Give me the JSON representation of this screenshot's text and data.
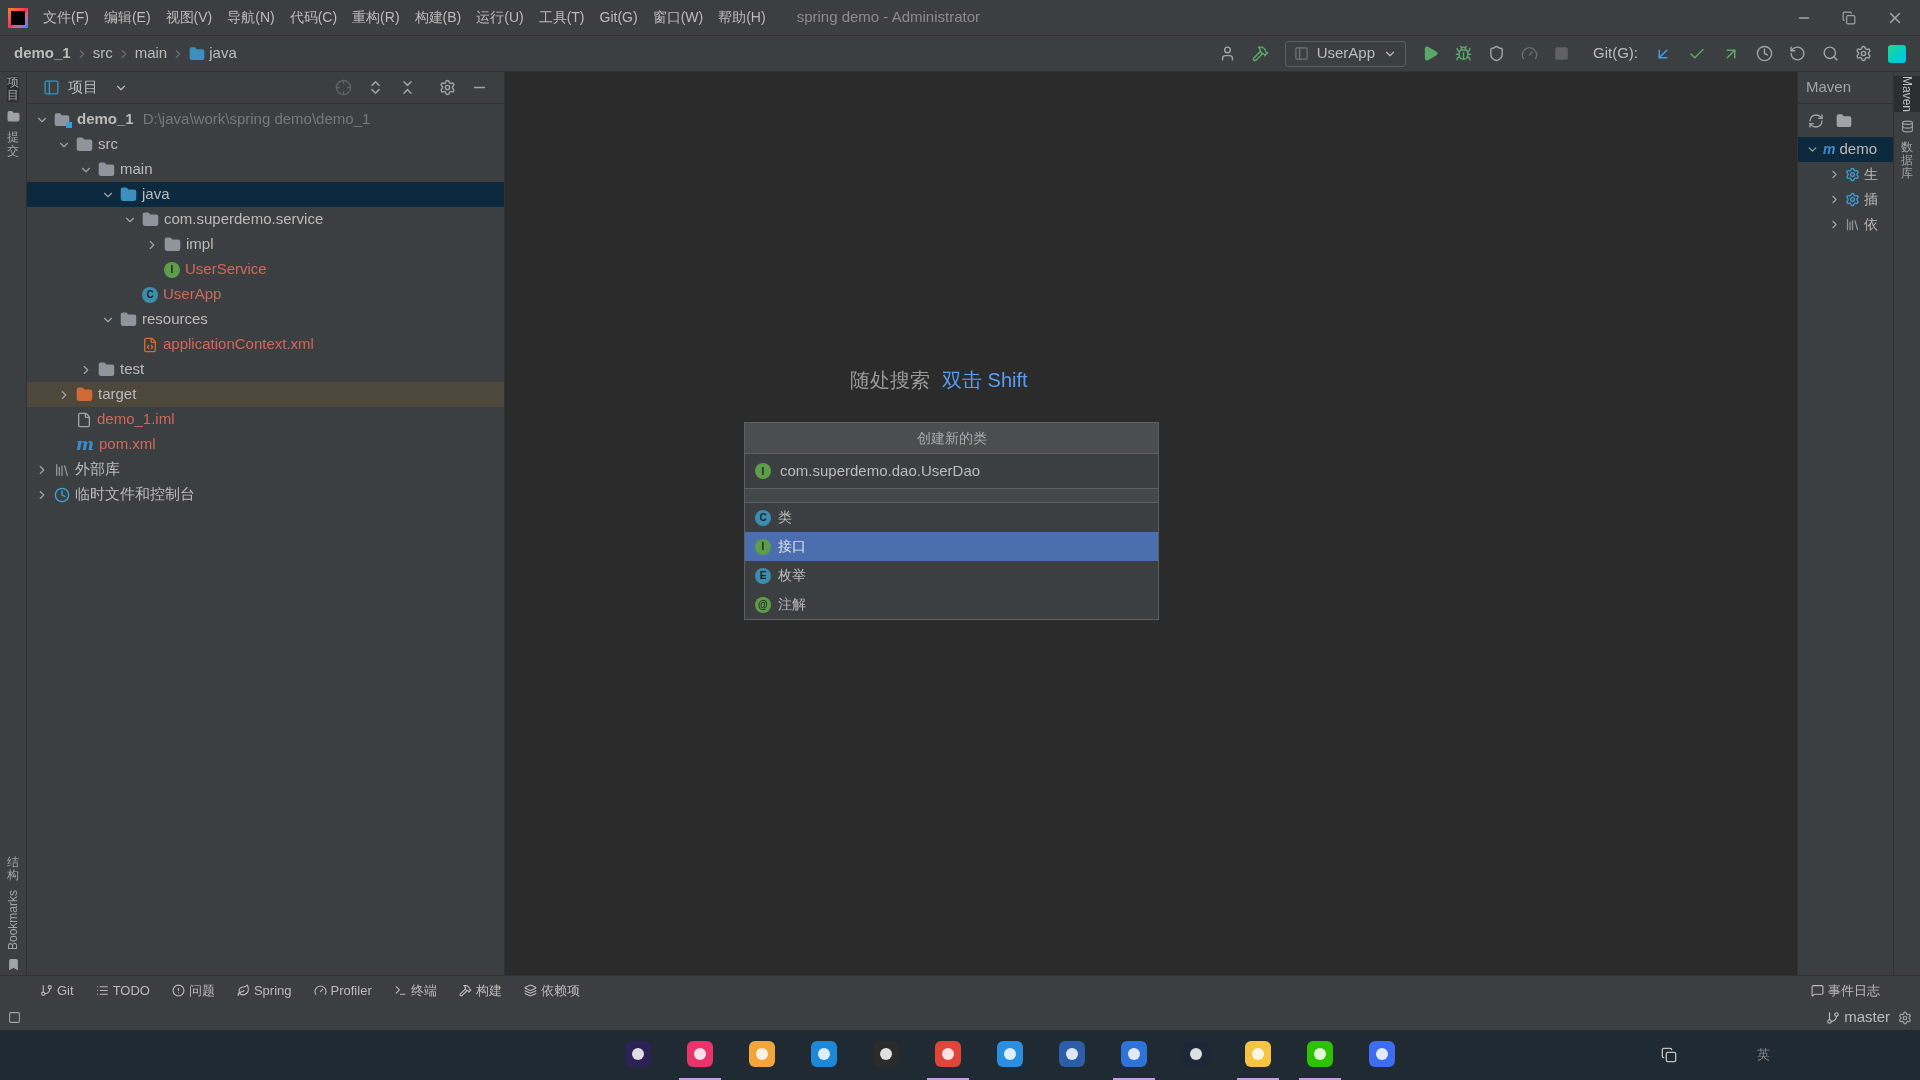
{
  "window": {
    "title": "spring demo - Administrator"
  },
  "menu": [
    "文件(F)",
    "编辑(E)",
    "视图(V)",
    "导航(N)",
    "代码(C)",
    "重构(R)",
    "构建(B)",
    "运行(U)",
    "工具(T)",
    "Git(G)",
    "窗口(W)",
    "帮助(H)"
  ],
  "breadcrumbs": [
    {
      "label": "demo_1",
      "kind": "module"
    },
    {
      "label": "src",
      "kind": "plain"
    },
    {
      "label": "main",
      "kind": "plain"
    },
    {
      "label": "java",
      "kind": "folder"
    }
  ],
  "toolbar": {
    "run_config": "UserApp",
    "git_label": "Git(G):"
  },
  "left_strip": [
    {
      "label": "项目",
      "selected": true
    },
    {
      "label": "提交",
      "selected": false
    },
    {
      "label": "结构",
      "selected": false
    },
    {
      "label": "Bookmarks",
      "selected": false
    }
  ],
  "project": {
    "title": "项目",
    "tree": [
      {
        "name": "demo_1",
        "hint": "D:\\java\\work\\spring demo\\demo_1",
        "kind": "module",
        "expanded": true,
        "selected": false,
        "unversioned": false,
        "children": [
          {
            "name": "src",
            "kind": "folder",
            "expanded": true,
            "selected": false,
            "unversioned": false,
            "children": [
              {
                "name": "main",
                "kind": "folder",
                "expanded": true,
                "selected": false,
                "unversioned": false,
                "children": [
                  {
                    "name": "java",
                    "kind": "source",
                    "expanded": true,
                    "selected": true,
                    "unversioned": false,
                    "children": [
                      {
                        "name": "com.superdemo.service",
                        "kind": "package",
                        "expanded": true,
                        "selected": false,
                        "unversioned": false,
                        "children": [
                          {
                            "name": "impl",
                            "kind": "package",
                            "expanded": false,
                            "selected": false,
                            "unversioned": false
                          },
                          {
                            "name": "UserService",
                            "kind": "interface",
                            "icon_letter": "I",
                            "selected": false,
                            "unversioned": true
                          }
                        ]
                      },
                      {
                        "name": "UserApp",
                        "kind": "class",
                        "icon_letter": "C",
                        "selected": false,
                        "unversioned": true
                      }
                    ]
                  },
                  {
                    "name": "resources",
                    "kind": "resources",
                    "expanded": true,
                    "selected": false,
                    "unversioned": false,
                    "children": [
                      {
                        "name": "applicationContext.xml",
                        "kind": "xml",
                        "selected": false,
                        "unversioned": true
                      }
                    ]
                  }
                ]
              },
              {
                "name": "test",
                "kind": "folder",
                "expanded": false,
                "selected": false,
                "unversioned": false
              }
            ]
          },
          {
            "name": "target",
            "kind": "excluded",
            "expanded": false,
            "selected": false,
            "unversioned": false
          },
          {
            "name": "demo_1.iml",
            "kind": "iml",
            "selected": false,
            "unversioned": true
          },
          {
            "name": "pom.xml",
            "kind": "maven",
            "icon_letter": "m",
            "selected": false,
            "unversioned": true
          }
        ]
      },
      {
        "name": "外部库",
        "kind": "library",
        "expanded": false,
        "selected": false,
        "unversioned": false
      },
      {
        "name": "临时文件和控制台",
        "kind": "scratch",
        "expanded": false,
        "selected": false,
        "unversioned": false
      }
    ]
  },
  "editor": {
    "hint_label": "随处搜索",
    "hint_shortcut": "双击 Shift"
  },
  "dialog": {
    "title": "创建新的类",
    "value": "com.superdemo.dao.UserDao",
    "value_icon_letter": "I",
    "options": [
      {
        "label": "类",
        "kind": "class",
        "icon_letter": "C",
        "selected": false
      },
      {
        "label": "接口",
        "kind": "interface",
        "icon_letter": "I",
        "selected": true
      },
      {
        "label": "枚举",
        "kind": "enum",
        "icon_letter": "E",
        "selected": false
      },
      {
        "label": "注解",
        "kind": "annotation",
        "icon_letter": "@",
        "selected": false
      }
    ]
  },
  "maven": {
    "title": "Maven",
    "tree": [
      {
        "name": "demo",
        "icon_letter": "m",
        "expanded": true,
        "children": [
          {
            "name": "生",
            "kind": "lifecycle"
          },
          {
            "name": "插",
            "kind": "plugins"
          },
          {
            "name": "依",
            "kind": "dependencies"
          }
        ]
      }
    ]
  },
  "right_strip": [
    {
      "label": "Maven",
      "selected": true
    },
    {
      "label": "数据库",
      "selected": false
    }
  ],
  "bottom_tools": [
    {
      "label": "Git",
      "kind": "git"
    },
    {
      "label": "TODO",
      "kind": "todo"
    },
    {
      "label": "问题",
      "kind": "problems"
    },
    {
      "label": "Spring",
      "kind": "spring"
    },
    {
      "label": "Profiler",
      "kind": "profiler"
    },
    {
      "label": "终端",
      "kind": "terminal"
    },
    {
      "label": "构建",
      "kind": "build"
    },
    {
      "label": "依赖项",
      "kind": "deps"
    }
  ],
  "event_log": "事件日志",
  "status": {
    "branch": "master"
  },
  "taskbar": {
    "apps": [
      {
        "kind": "eclipse",
        "active": false
      },
      {
        "kind": "idea",
        "active": true
      },
      {
        "kind": "swirl",
        "active": false
      },
      {
        "kind": "squares",
        "active": false
      },
      {
        "kind": "terminal",
        "active": false
      },
      {
        "kind": "chrome",
        "active": true
      },
      {
        "kind": "vscode",
        "active": false
      },
      {
        "kind": "visio",
        "active": false
      },
      {
        "kind": "todo",
        "active": true
      },
      {
        "kind": "steam",
        "active": false
      },
      {
        "kind": "explorer",
        "active": true
      },
      {
        "kind": "wechat",
        "active": true
      },
      {
        "kind": "player",
        "active": false
      }
    ],
    "ime": "英"
  }
}
